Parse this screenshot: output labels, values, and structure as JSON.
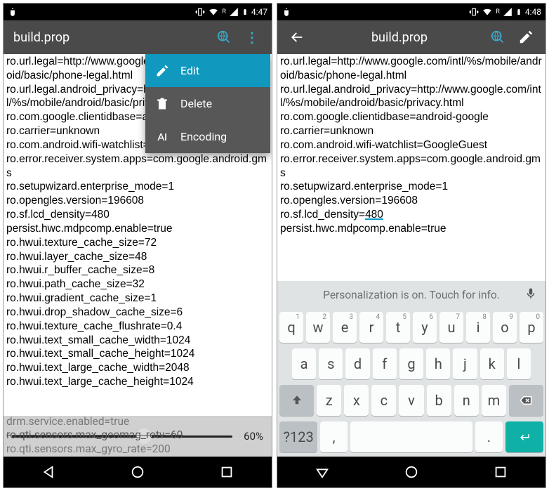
{
  "left": {
    "status_time": "4:47",
    "title": "build.prop",
    "menu": {
      "edit": "Edit",
      "delete": "Delete",
      "encoding": "Encoding"
    },
    "text": "ro.url.legal=http://www.google.com/intl/%s/mobile/android/basic/phone-legal.html\nro.url.legal.android_privacy=http://www.google.com/intl/%s/mobile/android/basic/privacy.html\nro.com.google.clientidbase=android-google\nro.carrier=unknown\nro.com.android.wifi-watchlist=GoogleGuest\nro.error.receiver.system.apps=com.google.android.gms\nro.setupwizard.enterprise_mode=1\nro.opengles.version=196608\nro.sf.lcd_density=480\npersist.hwc.mdpcomp.enable=true\nro.hwui.texture_cache_size=72\nro.hwui.layer_cache_size=48\nro.hwui.r_buffer_cache_size=8\nro.hwui.path_cache_size=32\nro.hwui.gradient_cache_size=1\nro.hwui.drop_shadow_cache_size=6\nro.hwui.texture_cache_flushrate=0.4\nro.hwui.text_small_cache_width=1024\nro.hwui.text_small_cache_height=1024\nro.hwui.text_large_cache_width=2048\nro.hwui.text_large_cache_height=1024",
    "faded1": "drm.service.enabled=true",
    "faded2": "ro.qti.sensors.max_geomag_rotv=60",
    "faded3": "ro.qti.sensors.max_gyro_rate=200",
    "seek_val": "60%"
  },
  "right": {
    "status_time": "4:48",
    "title": "build.prop",
    "text": "ro.url.legal=http://www.google.com/intl/%s/mobile/android/basic/phone-legal.html\nro.url.legal.android_privacy=http://www.google.com/intl/%s/mobile/android/basic/privacy.html\nro.com.google.clientidbase=android-google\nro.carrier=unknown\nro.com.android.wifi-watchlist=GoogleGuest\nro.error.receiver.system.apps=com.google.android.gms\nro.setupwizard.enterprise_mode=1\nro.opengles.version=196608\nro.sf.lcd_density=480\npersist.hwc.mdpcomp.enable=true",
    "cursor_line_prefix": "ro.sf.lcd_density=",
    "cursor_value": "480",
    "suggest": "Personalization is on. Touch for info.",
    "row1": [
      "q",
      "w",
      "e",
      "r",
      "t",
      "y",
      "u",
      "i",
      "o",
      "p"
    ],
    "row1num": [
      "1",
      "2",
      "3",
      "4",
      "5",
      "6",
      "7",
      "8",
      "9",
      "0"
    ],
    "row2": [
      "a",
      "s",
      "d",
      "f",
      "g",
      "h",
      "j",
      "k",
      "l"
    ],
    "row3": [
      "z",
      "x",
      "c",
      "v",
      "b",
      "n",
      "m"
    ],
    "symkey": "?123",
    "comma": ",",
    "period": "."
  }
}
